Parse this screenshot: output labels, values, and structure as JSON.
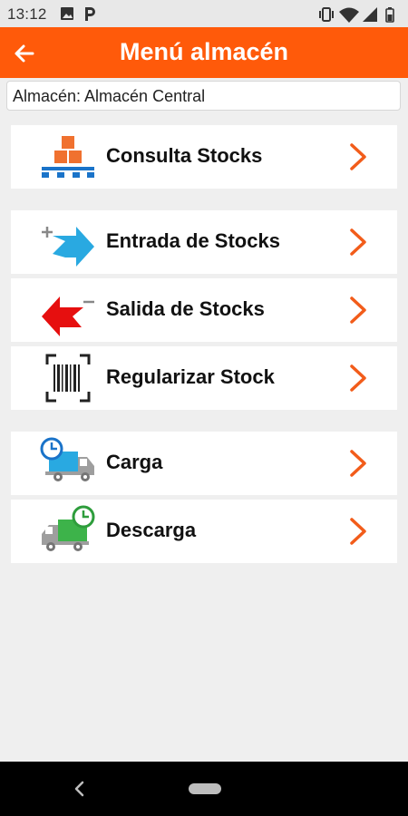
{
  "status_bar": {
    "time": "13:12",
    "left_icons": [
      "image-icon",
      "parking-icon"
    ],
    "right_icons": [
      "vibrate-icon",
      "wifi-icon",
      "signal-icon",
      "battery-icon"
    ]
  },
  "header": {
    "title": "Menú almacén",
    "back_icon": "back-arrow-icon",
    "background_color": "#ff5a0a"
  },
  "warehouse": {
    "label": "Almacén: Almacén Central"
  },
  "menu_items": [
    {
      "label": "Consulta Stocks",
      "icon": "stock-pallet-icon"
    },
    {
      "label": "Entrada de Stocks",
      "icon": "stock-in-arrow-icon"
    },
    {
      "label": "Salida de Stocks",
      "icon": "stock-out-arrow-icon"
    },
    {
      "label": "Regularizar Stock",
      "icon": "barcode-scan-icon"
    },
    {
      "label": "Carga",
      "icon": "truck-load-icon"
    },
    {
      "label": "Descarga",
      "icon": "truck-unload-icon"
    }
  ],
  "accent_color": "#f25c1a",
  "nav_bar": {
    "icons": [
      "nav-back-icon",
      "nav-home-pill"
    ]
  }
}
